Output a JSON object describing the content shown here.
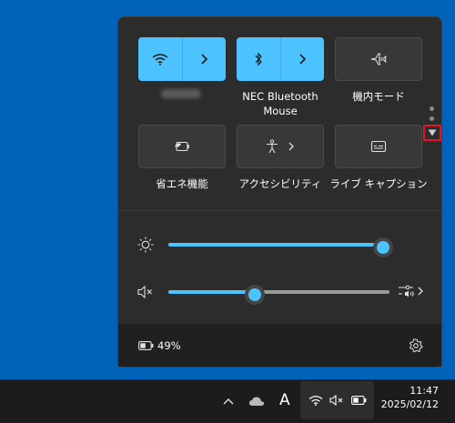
{
  "quick_settings": {
    "tiles": [
      {
        "label": "",
        "state": "on",
        "icon": "wifi-icon"
      },
      {
        "label": "NEC Bluetooth Mouse",
        "state": "on",
        "icon": "bluetooth-icon"
      },
      {
        "label": "機内モード",
        "state": "off",
        "icon": "airplane-icon"
      },
      {
        "label": "省エネ機能",
        "state": "off",
        "icon": "battery-saver-icon"
      },
      {
        "label": "アクセシビリティ",
        "state": "off",
        "icon": "accessibility-icon"
      },
      {
        "label": "ライブ キャプション",
        "state": "off",
        "icon": "live-caption-icon"
      }
    ],
    "brightness": {
      "level": 0.97,
      "icon": "brightness-icon"
    },
    "volume": {
      "level": 0.39,
      "muted": true,
      "icon": "volume-muted-icon"
    },
    "battery": {
      "percent": "49%"
    }
  },
  "taskbar": {
    "time": "11:47",
    "date": "2025/02/12",
    "ime": "A"
  },
  "colors": {
    "accent": "#4cc2ff",
    "desktop": "#0062b8",
    "panel": "#2c2c2c",
    "highlight": "#e81123"
  }
}
